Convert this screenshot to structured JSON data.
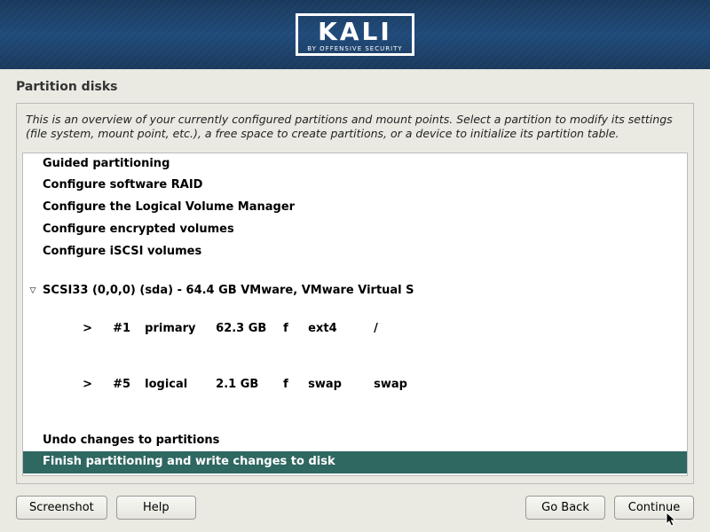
{
  "header": {
    "logo_text": "KALI",
    "logo_sub": "BY OFFENSIVE SECURITY"
  },
  "page": {
    "title": "Partition disks",
    "instructions": "This is an overview of your currently configured partitions and mount points. Select a partition to modify its settings (file system, mount point, etc.), a free space to create partitions, or a device to initialize its partition table."
  },
  "menu": {
    "guided": "Guided partitioning",
    "raid": "Configure software RAID",
    "lvm": "Configure the Logical Volume Manager",
    "encrypted": "Configure encrypted volumes",
    "iscsi": "Configure iSCSI volumes",
    "disk": "SCSI33 (0,0,0) (sda) - 64.4 GB VMware, VMware Virtual S",
    "undo": "Undo changes to partitions",
    "finish": "Finish partitioning and write changes to disk"
  },
  "partitions": [
    {
      "ind": ">",
      "num": "#1",
      "type": "primary",
      "size": "62.3 GB",
      "flag": "f",
      "fs": "ext4",
      "mount": "/"
    },
    {
      "ind": ">",
      "num": "#5",
      "type": "logical",
      "size": "2.1 GB",
      "flag": "f",
      "fs": "swap",
      "mount": "swap"
    }
  ],
  "buttons": {
    "screenshot": "Screenshot",
    "help": "Help",
    "go_back": "Go Back",
    "continue": "Continue"
  }
}
